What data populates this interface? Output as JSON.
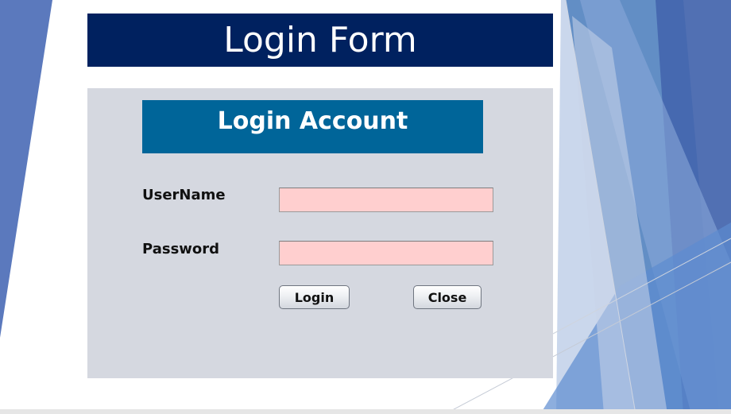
{
  "slide": {
    "title": "Login Form"
  },
  "form": {
    "header": "Login Account",
    "username": {
      "label": "UserName",
      "value": "",
      "background": "#ffcfcf"
    },
    "password": {
      "label": "Password",
      "value": "",
      "background": "#ffcfcf"
    },
    "buttons": {
      "login": "Login",
      "close": "Close"
    }
  },
  "colors": {
    "title_bar": "#00215f",
    "panel_header": "#006599",
    "panel_background": "#d5d8e0",
    "decor_blue": "#4f6eb5"
  }
}
